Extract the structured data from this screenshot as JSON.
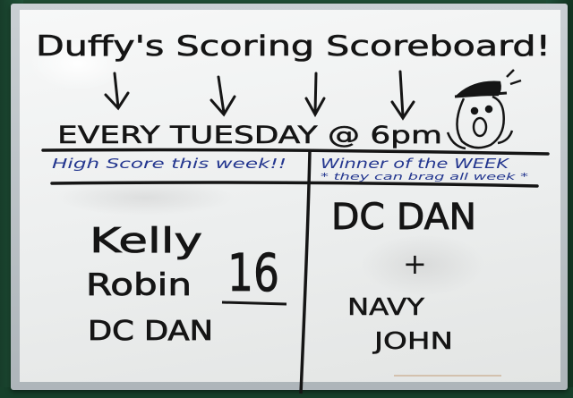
{
  "board": {
    "title": "Duffy's Scoring Scoreboard!",
    "schedule": "EVERY TUESDAY @ 6pm",
    "left_header": "High Score this week!!",
    "right_header": "Winner of the WEEK",
    "right_subheader": "* they can brag all week *",
    "high_scorers": [
      "Kelly",
      "Robin",
      "DC DAN"
    ],
    "high_score": "16",
    "weekly_winner_1": "DC DAN",
    "plus": "+",
    "weekly_winner_2a": "NAVY",
    "weekly_winner_2b": "JOHN"
  },
  "colors": {
    "marker_black": "#151515",
    "marker_blue": "#23368f",
    "board_white": "#f2f3f3",
    "wall_green": "#1f4d34",
    "frame_silver": "#b8bfc4"
  }
}
